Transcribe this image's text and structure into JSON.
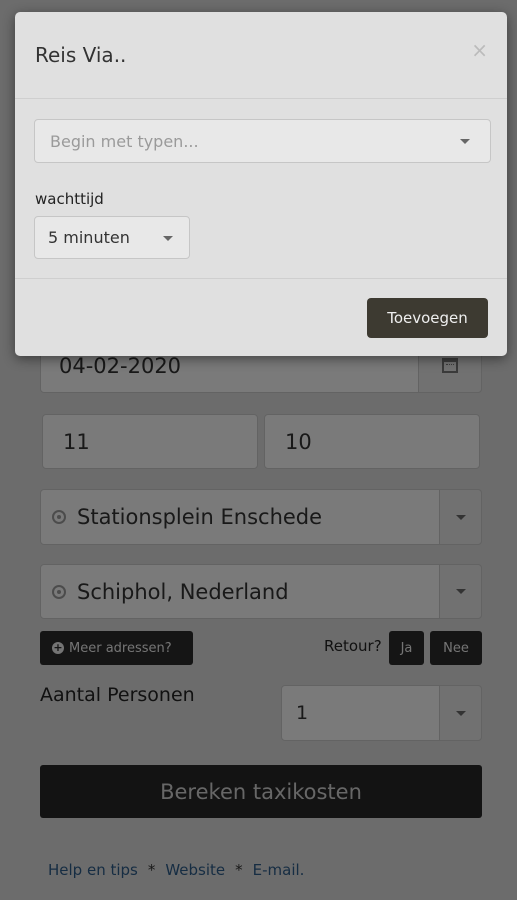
{
  "form": {
    "date": "04-02-2020",
    "hour": "11",
    "minute": "10",
    "from": "Stationsplein Enschede",
    "to": "Schiphol, Nederland",
    "more_addresses": "Meer adressen?",
    "retour_label": "Retour?",
    "retour_yes": "Ja",
    "retour_no": "Nee",
    "persons_label": "Aantal Personen",
    "persons_value": "1",
    "calculate": "Bereken taxikosten"
  },
  "footer": {
    "help": "Help en tips",
    "website": "Website",
    "email": "E-mail.",
    "separator": "*"
  },
  "modal": {
    "title": "Reis Via..",
    "close": "×",
    "search_placeholder": "Begin met typen...",
    "wait_label": "wachttijd",
    "wait_value": "5 minuten",
    "add": "Toevoegen"
  }
}
